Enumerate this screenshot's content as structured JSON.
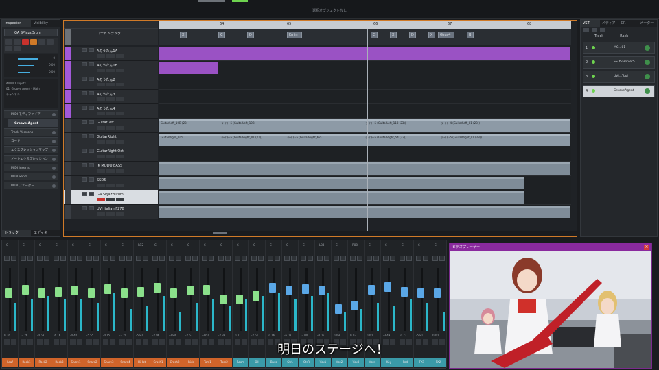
{
  "window": {
    "title": "選択オブジェクトなし"
  },
  "inspector": {
    "tabs": [
      "Inspector",
      "Visibility"
    ],
    "track_name": "GA SPJazzDrum",
    "routing": [
      "All MIDI Inputs",
      "01. Groove Agent - Main",
      "チャンネル"
    ],
    "sections": [
      "MIDI モディファイアー",
      "Groove Agent",
      "Track Versions",
      "コード",
      "エクスプレッションマップ",
      "ノートエクスプレッション",
      "MIDI Inserts",
      "MIDI Send",
      "MIDI フェーダー"
    ],
    "bottom_tabs": [
      "トラック",
      "エディター"
    ],
    "slider_values": [
      "0",
      "0.00",
      "0.00"
    ]
  },
  "project": {
    "ruler_numbers": [
      "64",
      "65",
      "66",
      "67",
      "68"
    ],
    "chord_track_name": "コードトラック",
    "chords": [
      "X",
      "C",
      "D",
      "Emin",
      "C",
      "X",
      "D",
      "X",
      "Gsus4",
      "B"
    ],
    "tracks": [
      {
        "name": "Aのうたん1A",
        "color": "#a259d9",
        "kind": "audio"
      },
      {
        "name": "Aのうたん1B",
        "color": "#a259d9",
        "kind": "audio"
      },
      {
        "name": "Aのうたん2",
        "color": "#a259d9",
        "kind": "audio"
      },
      {
        "name": "Aのうたん3",
        "color": "#a259d9",
        "kind": "audio"
      },
      {
        "name": "Aのうたん4",
        "color": "#a259d9",
        "kind": "audio"
      },
      {
        "name": "GuitarLeft",
        "color": "#3a3e44",
        "kind": "audio"
      },
      {
        "name": "GuitarRight",
        "color": "#3a3e44",
        "kind": "audio"
      },
      {
        "name": "GuitarRight Oct",
        "color": "#3a3e44",
        "kind": "audio"
      },
      {
        "name": "IK MODO BASS",
        "color": "#3a3e44",
        "kind": "inst"
      },
      {
        "name": "SSD5",
        "color": "#3a3e44",
        "kind": "inst"
      },
      {
        "name": "GA SPJazzDrum",
        "color": "#3a3e44",
        "kind": "inst"
      },
      {
        "name": "UVI Italian F278",
        "color": "#3a3e44",
        "kind": "inst"
      }
    ],
    "event_labels": {
      "guitar_left": [
        "GuitarLeft_10B (23)",
        "ライト-5 (GuitarLeft_10B)",
        "ライト-5 (GuitarLeft_118 (23))",
        "ライト-4 (GuitarLeft_01 (23))"
      ],
      "guitar_right": [
        "GuitarRight_105",
        "ライト-5 (GuitarRight_01 (23))",
        "ライト-5 (GuitarRight_62)",
        "ライト-5 (GuitarRight_54 (23))",
        "ライト-5 (GuitarRight_01 (23))"
      ]
    }
  },
  "rightzone": {
    "tabs": [
      "VSTi",
      "メディア",
      "CR",
      "メーター"
    ],
    "headers": [
      "Track",
      "Rack"
    ],
    "instruments": [
      {
        "num": "1",
        "name": "MO...01"
      },
      {
        "num": "2",
        "name": "SSDSampler5"
      },
      {
        "num": "3",
        "name": "UVI...Tool"
      },
      {
        "num": "4",
        "name": "GrooveAgent"
      }
    ]
  },
  "mixer": {
    "channels": [
      {
        "name": "Leaf",
        "color": "#d0642a",
        "val": "0.26",
        "pan": "C",
        "fader": 0.6,
        "meter": 0.45,
        "cap": "#8be08b"
      },
      {
        "name": "Rock1",
        "color": "#d0642a",
        "val": "-3.26",
        "pan": "C",
        "fader": 0.65,
        "meter": 0.5,
        "cap": "#8be08b"
      },
      {
        "name": "Rock2",
        "color": "#d0642a",
        "val": "-0.58",
        "pan": "C",
        "fader": 0.6,
        "meter": 0.55,
        "cap": "#8be08b"
      },
      {
        "name": "Rock3",
        "color": "#d0642a",
        "val": "-6.16",
        "pan": "C",
        "fader": 0.62,
        "meter": 0.5,
        "cap": "#8be08b"
      },
      {
        "name": "Snare1",
        "color": "#d0642a",
        "val": "-4.47",
        "pan": "C",
        "fader": 0.64,
        "meter": 0.5,
        "cap": "#8be08b"
      },
      {
        "name": "Snare2",
        "color": "#d0642a",
        "val": "-5.55",
        "pan": "C",
        "fader": 0.6,
        "meter": 0.45,
        "cap": "#8be08b"
      },
      {
        "name": "Snare3",
        "color": "#d0642a",
        "val": "-0.15",
        "pan": "C",
        "fader": 0.66,
        "meter": 0.6,
        "cap": "#8be08b"
      },
      {
        "name": "Snare4",
        "color": "#d0642a",
        "val": "-3.20",
        "pan": "C",
        "fader": 0.6,
        "meter": 0.35,
        "cap": "#8be08b"
      },
      {
        "name": "HiHat",
        "color": "#d0642a",
        "val": "-5.82",
        "pan": "R12",
        "fader": 0.62,
        "meter": 0.4,
        "cap": "#8be08b"
      },
      {
        "name": "Crash1",
        "color": "#d0642a",
        "val": "-2.96",
        "pan": "C",
        "fader": 0.68,
        "meter": 0.55,
        "cap": "#8be08b"
      },
      {
        "name": "Crash2",
        "color": "#d0642a",
        "val": "-3.84",
        "pan": "C",
        "fader": 0.6,
        "meter": 0.3,
        "cap": "#8be08b"
      },
      {
        "name": "Ride",
        "color": "#d0642a",
        "val": "-2.67",
        "pan": "C",
        "fader": 0.64,
        "meter": 0.45,
        "cap": "#8be08b"
      },
      {
        "name": "Tom1",
        "color": "#d0642a",
        "val": "-3.62",
        "pan": "C",
        "fader": 0.65,
        "meter": 0.5,
        "cap": "#8be08b"
      },
      {
        "name": "Tom2",
        "color": "#d0642a",
        "val": "-2.33",
        "pan": "C",
        "fader": 0.5,
        "meter": 0.4,
        "cap": "#8be08b"
      },
      {
        "name": "Room",
        "color": "#3a9aa8",
        "val": "0.21",
        "pan": "C",
        "fader": 0.5,
        "meter": 0.5,
        "cap": "#8be08b"
      },
      {
        "name": "OH",
        "color": "#3a9aa8",
        "val": "-2.51",
        "pan": "C",
        "fader": 0.55,
        "meter": 0.55,
        "cap": "#8be08b"
      },
      {
        "name": "Bass",
        "color": "#3a9aa8",
        "val": "-0.16",
        "pan": "C",
        "fader": 0.68,
        "meter": 0.6,
        "cap": "#5aa7e6"
      },
      {
        "name": "GtrL",
        "color": "#3a9aa8",
        "val": "-6.08",
        "pan": "C",
        "fader": 0.64,
        "meter": 0.5,
        "cap": "#5aa7e6"
      },
      {
        "name": "GtrR",
        "color": "#3a9aa8",
        "val": "-3.00",
        "pan": "C",
        "fader": 0.66,
        "meter": 0.55,
        "cap": "#5aa7e6"
      },
      {
        "name": "Vox1",
        "color": "#3a9aa8",
        "val": "-0.06",
        "pan": "L84",
        "fader": 0.64,
        "meter": 0.6,
        "cap": "#5aa7e6"
      },
      {
        "name": "Vox2",
        "color": "#3a9aa8",
        "val": "0.09",
        "pan": "C",
        "fader": 0.35,
        "meter": 0.3,
        "cap": "#5aa7e6"
      },
      {
        "name": "Vox3",
        "color": "#3a9aa8",
        "val": "0.03",
        "pan": "R88",
        "fader": 0.4,
        "meter": 0.35,
        "cap": "#5aa7e6"
      },
      {
        "name": "Vox4",
        "color": "#3a9aa8",
        "val": "0.00",
        "pan": "C",
        "fader": 0.65,
        "meter": 0.45,
        "cap": "#5aa7e6"
      },
      {
        "name": "Key",
        "color": "#3a9aa8",
        "val": "-3.49",
        "pan": "C",
        "fader": 0.7,
        "meter": 0.4,
        "cap": "#5aa7e6"
      },
      {
        "name": "Pad",
        "color": "#3a9aa8",
        "val": "-0.72",
        "pan": "C",
        "fader": 0.62,
        "meter": 0.5,
        "cap": "#5aa7e6"
      },
      {
        "name": "FX1",
        "color": "#3a9aa8",
        "val": "-5.81",
        "pan": "C",
        "fader": 0.6,
        "meter": 0.45,
        "cap": "#5aa7e6"
      },
      {
        "name": "FX2",
        "color": "#3a9aa8",
        "val": "0.00",
        "pan": "C",
        "fader": 0.6,
        "meter": 0.3,
        "cap": "#5aa7e6"
      }
    ]
  },
  "video": {
    "title": "ビデオプレーヤー",
    "close": "×"
  },
  "subtitle": "明日のステージへ！",
  "colors": {
    "accent": "#d07a28",
    "purple": "#a259d9",
    "meter": "#2bb7c9"
  }
}
